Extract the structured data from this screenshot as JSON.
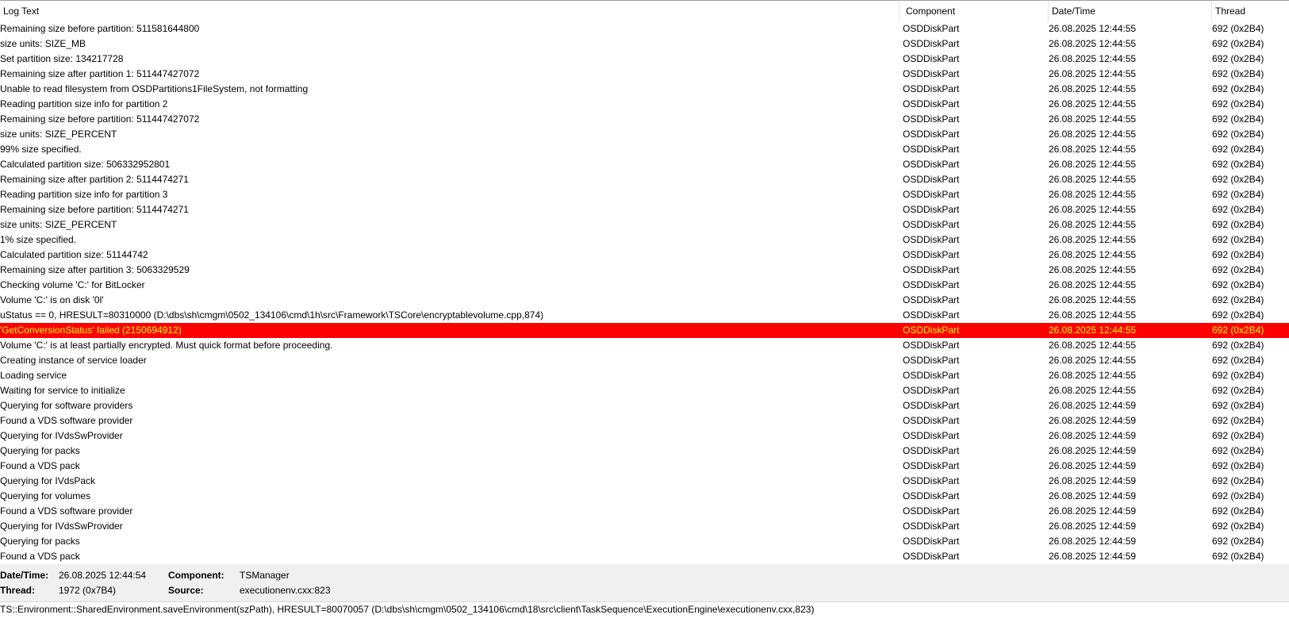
{
  "columns": {
    "log_text": "Log Text",
    "component": "Component",
    "date_time": "Date/Time",
    "thread": "Thread"
  },
  "rows": [
    {
      "text": "Remaining size before partition: 511581644800",
      "component": "OSDDiskPart",
      "datetime": "26.08.2025 12:44:55",
      "thread": "692 (0x2B4)"
    },
    {
      "text": "size units: SIZE_MB",
      "component": "OSDDiskPart",
      "datetime": "26.08.2025 12:44:55",
      "thread": "692 (0x2B4)"
    },
    {
      "text": "Set partition size: 134217728",
      "component": "OSDDiskPart",
      "datetime": "26.08.2025 12:44:55",
      "thread": "692 (0x2B4)"
    },
    {
      "text": "Remaining size after partition 1: 511447427072",
      "component": "OSDDiskPart",
      "datetime": "26.08.2025 12:44:55",
      "thread": "692 (0x2B4)"
    },
    {
      "text": "Unable to read filesystem from OSDPartitions1FileSystem, not formatting",
      "component": "OSDDiskPart",
      "datetime": "26.08.2025 12:44:55",
      "thread": "692 (0x2B4)"
    },
    {
      "text": "Reading partition size info for partition 2",
      "component": "OSDDiskPart",
      "datetime": "26.08.2025 12:44:55",
      "thread": "692 (0x2B4)"
    },
    {
      "text": "Remaining size before partition: 511447427072",
      "component": "OSDDiskPart",
      "datetime": "26.08.2025 12:44:55",
      "thread": "692 (0x2B4)"
    },
    {
      "text": "size units: SIZE_PERCENT",
      "component": "OSDDiskPart",
      "datetime": "26.08.2025 12:44:55",
      "thread": "692 (0x2B4)"
    },
    {
      "text": "99% size specified.",
      "component": "OSDDiskPart",
      "datetime": "26.08.2025 12:44:55",
      "thread": "692 (0x2B4)"
    },
    {
      "text": "Calculated partition size: 506332952801",
      "component": "OSDDiskPart",
      "datetime": "26.08.2025 12:44:55",
      "thread": "692 (0x2B4)"
    },
    {
      "text": "Remaining size after partition 2: 5114474271",
      "component": "OSDDiskPart",
      "datetime": "26.08.2025 12:44:55",
      "thread": "692 (0x2B4)"
    },
    {
      "text": "Reading partition size info for partition 3",
      "component": "OSDDiskPart",
      "datetime": "26.08.2025 12:44:55",
      "thread": "692 (0x2B4)"
    },
    {
      "text": "Remaining size before partition: 5114474271",
      "component": "OSDDiskPart",
      "datetime": "26.08.2025 12:44:55",
      "thread": "692 (0x2B4)"
    },
    {
      "text": "size units: SIZE_PERCENT",
      "component": "OSDDiskPart",
      "datetime": "26.08.2025 12:44:55",
      "thread": "692 (0x2B4)"
    },
    {
      "text": "1% size specified.",
      "component": "OSDDiskPart",
      "datetime": "26.08.2025 12:44:55",
      "thread": "692 (0x2B4)"
    },
    {
      "text": "Calculated partition size: 51144742",
      "component": "OSDDiskPart",
      "datetime": "26.08.2025 12:44:55",
      "thread": "692 (0x2B4)"
    },
    {
      "text": "Remaining size after partition 3: 5063329529",
      "component": "OSDDiskPart",
      "datetime": "26.08.2025 12:44:55",
      "thread": "692 (0x2B4)"
    },
    {
      "text": "Checking volume 'C:' for BitLocker",
      "component": "OSDDiskPart",
      "datetime": "26.08.2025 12:44:55",
      "thread": "692 (0x2B4)"
    },
    {
      "text": "Volume 'C:' is on disk '0l'",
      "component": "OSDDiskPart",
      "datetime": "26.08.2025 12:44:55",
      "thread": "692 (0x2B4)"
    },
    {
      "text": "uStatus == 0, HRESULT=80310000 (D:\\dbs\\sh\\cmgm\\0502_134106\\cmd\\1h\\src\\Framework\\TSCore\\encryptablevolume.cpp,874)",
      "component": "OSDDiskPart",
      "datetime": "26.08.2025 12:44:55",
      "thread": "692 (0x2B4)"
    },
    {
      "text": "'GetConversionStatus' failed (2150694912)",
      "component": "OSDDiskPart",
      "datetime": "26.08.2025 12:44:55",
      "thread": "692 (0x2B4)",
      "error": true
    },
    {
      "text": "Volume 'C:' is at least partially encrypted.  Must quick format before proceeding.",
      "component": "OSDDiskPart",
      "datetime": "26.08.2025 12:44:55",
      "thread": "692 (0x2B4)"
    },
    {
      "text": "Creating instance of service loader",
      "component": "OSDDiskPart",
      "datetime": "26.08.2025 12:44:55",
      "thread": "692 (0x2B4)"
    },
    {
      "text": "Loading service",
      "component": "OSDDiskPart",
      "datetime": "26.08.2025 12:44:55",
      "thread": "692 (0x2B4)"
    },
    {
      "text": "Waiting for service to initialize",
      "component": "OSDDiskPart",
      "datetime": "26.08.2025 12:44:55",
      "thread": "692 (0x2B4)"
    },
    {
      "text": "Querying for software providers",
      "component": "OSDDiskPart",
      "datetime": "26.08.2025 12:44:59",
      "thread": "692 (0x2B4)"
    },
    {
      "text": "Found a VDS software provider",
      "component": "OSDDiskPart",
      "datetime": "26.08.2025 12:44:59",
      "thread": "692 (0x2B4)"
    },
    {
      "text": "Querying for IVdsSwProvider",
      "component": "OSDDiskPart",
      "datetime": "26.08.2025 12:44:59",
      "thread": "692 (0x2B4)"
    },
    {
      "text": "Querying for packs",
      "component": "OSDDiskPart",
      "datetime": "26.08.2025 12:44:59",
      "thread": "692 (0x2B4)"
    },
    {
      "text": "Found a VDS pack",
      "component": "OSDDiskPart",
      "datetime": "26.08.2025 12:44:59",
      "thread": "692 (0x2B4)"
    },
    {
      "text": "Querying for IVdsPack",
      "component": "OSDDiskPart",
      "datetime": "26.08.2025 12:44:59",
      "thread": "692 (0x2B4)"
    },
    {
      "text": "Querying for volumes",
      "component": "OSDDiskPart",
      "datetime": "26.08.2025 12:44:59",
      "thread": "692 (0x2B4)"
    },
    {
      "text": "Found a VDS software provider",
      "component": "OSDDiskPart",
      "datetime": "26.08.2025 12:44:59",
      "thread": "692 (0x2B4)"
    },
    {
      "text": "Querying for IVdsSwProvider",
      "component": "OSDDiskPart",
      "datetime": "26.08.2025 12:44:59",
      "thread": "692 (0x2B4)"
    },
    {
      "text": "Querying for packs",
      "component": "OSDDiskPart",
      "datetime": "26.08.2025 12:44:59",
      "thread": "692 (0x2B4)"
    },
    {
      "text": "Found a VDS pack",
      "component": "OSDDiskPart",
      "datetime": "26.08.2025 12:44:59",
      "thread": "692 (0x2B4)"
    }
  ],
  "details": {
    "datetime_label": "Date/Time:",
    "datetime_value": "26.08.2025 12:44:54",
    "component_label": "Component:",
    "component_value": "TSManager",
    "thread_label": "Thread:",
    "thread_value": "1972 (0x7B4)",
    "source_label": "Source:",
    "source_value": "executionenv.cxx:823",
    "message": "TS::Environment::SharedEnvironment.saveEnvironment(szPath), HRESULT=80070057 (D:\\dbs\\sh\\cmgm\\0502_134106\\cmd\\18\\src\\client\\TaskSequence\\ExecutionEngine\\executionenv.cxx,823)"
  },
  "colors": {
    "error_row_background": "#ff0000",
    "error_row_text": "#ffff00",
    "details_background": "#f0f0f0"
  }
}
